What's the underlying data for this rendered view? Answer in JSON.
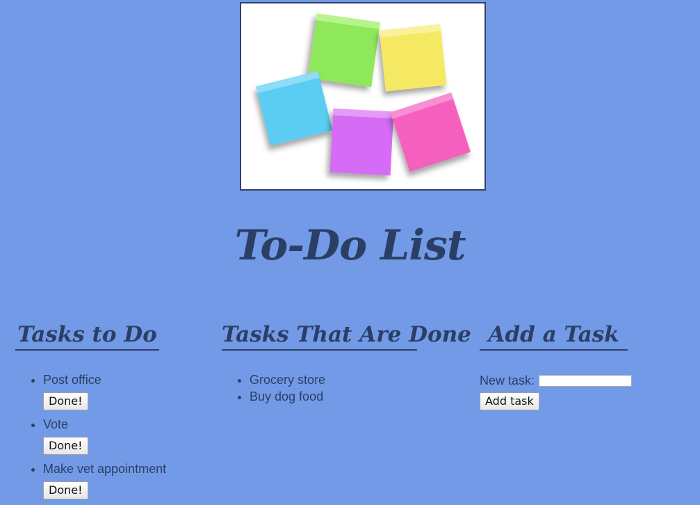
{
  "hero": {
    "image_name": "sticky-notes-image",
    "note_colors": [
      "#8ee85a",
      "#f5e963",
      "#5ccdf2",
      "#d66cf5",
      "#f55fbe"
    ]
  },
  "title": "To-Do List",
  "todo": {
    "heading": "Tasks to Do",
    "items": [
      {
        "text": "Post office",
        "button": "Done!"
      },
      {
        "text": "Vote",
        "button": "Done!"
      },
      {
        "text": "Make vet appointment",
        "button": "Done!"
      }
    ]
  },
  "done": {
    "heading": "Tasks That Are Done",
    "items": [
      {
        "text": "Grocery store"
      },
      {
        "text": "Buy dog food"
      }
    ]
  },
  "add": {
    "heading": "Add a Task",
    "label": "New task:",
    "value": "",
    "placeholder": "",
    "button": "Add task"
  },
  "colors": {
    "background": "#729ae6",
    "text": "#2b3f66"
  }
}
